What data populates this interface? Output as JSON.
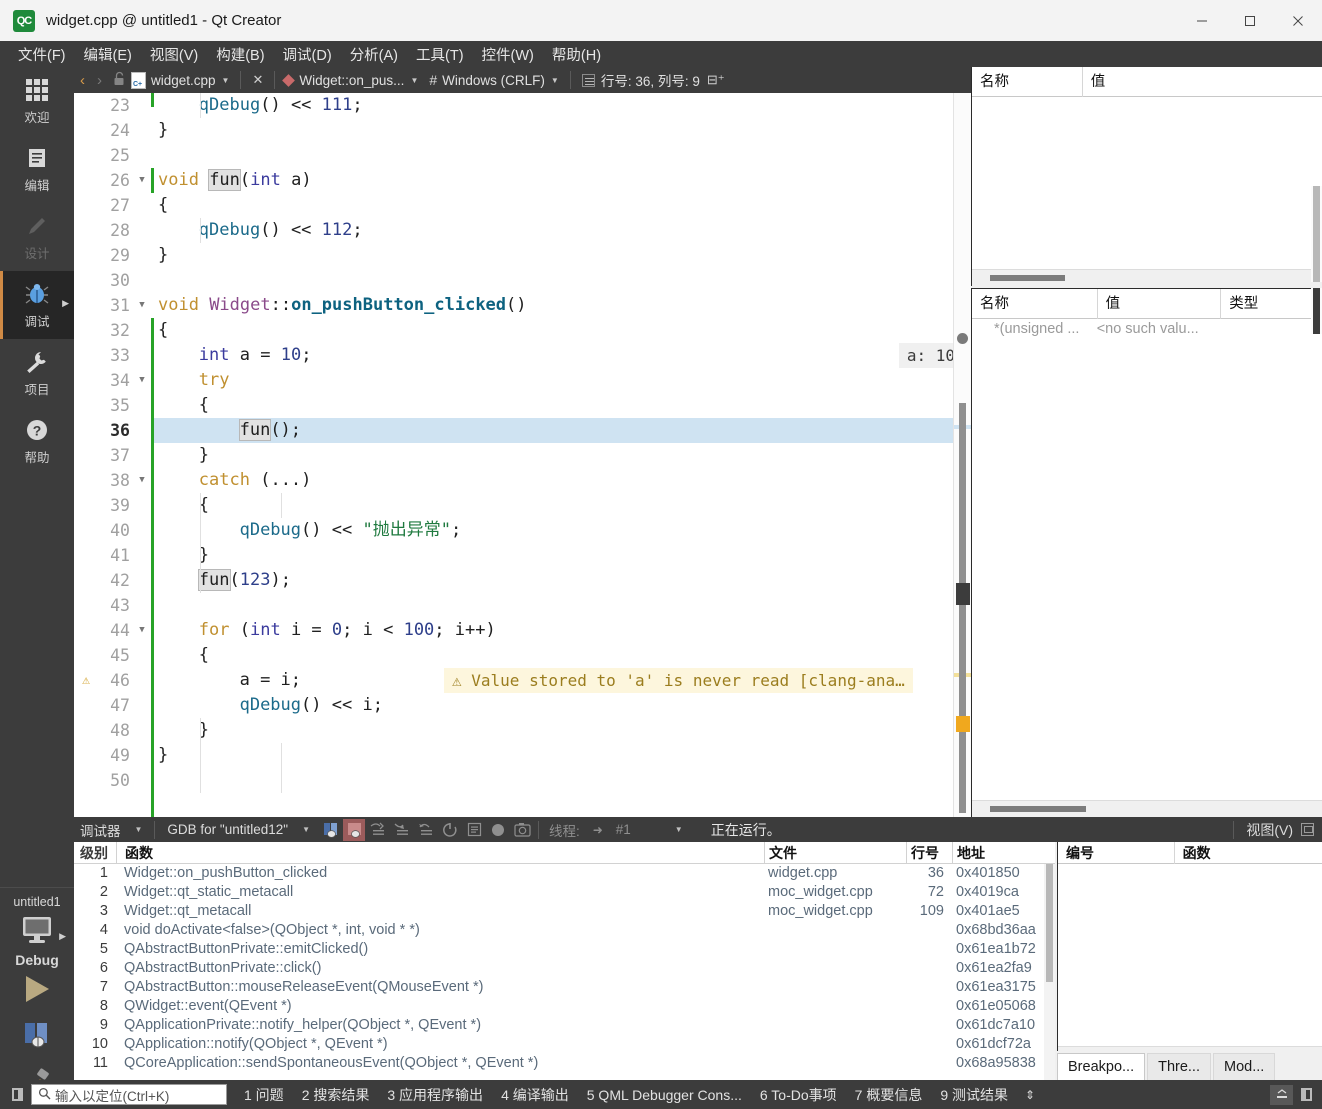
{
  "window": {
    "title": "widget.cpp @ untitled1 - Qt Creator",
    "app_badge": "QC",
    "minimize": "minimize-button",
    "maximize": "maximize-button",
    "close": "close-button"
  },
  "menubar": [
    {
      "label": "文件(F)",
      "key": "F"
    },
    {
      "label": "编辑(E)",
      "key": "E"
    },
    {
      "label": "视图(V)",
      "key": "V"
    },
    {
      "label": "构建(B)",
      "key": "B"
    },
    {
      "label": "调试(D)",
      "key": "D"
    },
    {
      "label": "分析(A)",
      "key": "A"
    },
    {
      "label": "工具(T)",
      "key": "T"
    },
    {
      "label": "控件(W)",
      "key": "W"
    },
    {
      "label": "帮助(H)",
      "key": "H"
    }
  ],
  "modebar": [
    {
      "label": "欢迎",
      "icon": "grid-icon",
      "state": "normal"
    },
    {
      "label": "编辑",
      "icon": "document-icon",
      "state": "normal"
    },
    {
      "label": "设计",
      "icon": "pencil-icon",
      "state": "disabled"
    },
    {
      "label": "调试",
      "icon": "bug-icon",
      "state": "active"
    },
    {
      "label": "项目",
      "icon": "wrench-icon",
      "state": "normal"
    },
    {
      "label": "帮助",
      "icon": "question-icon",
      "state": "normal"
    }
  ],
  "runblock": {
    "project": "untitled1",
    "kit_icon": "monitor-icon",
    "kit_label": "Debug",
    "run_icon": "run-triangle-icon",
    "debug_icon": "debug-start-icon",
    "build_icon": "hammer-icon"
  },
  "editor_toolbar": {
    "back": "‹",
    "forward": "›",
    "lock": "unlocked-icon",
    "filename": "widget.cpp",
    "close_label": "✕",
    "symbol": "Widget::on_pus...",
    "hash": "#",
    "line_ending": "Windows (CRLF)",
    "encoding_icon": "text-encoding-icon",
    "cursor_position": "行号: 36, 列号: 9",
    "split_icon": "split-editor-icon"
  },
  "code": {
    "lines": [
      {
        "n": "23",
        "indent": 4,
        "tokens": [
          {
            "t": "qDebug",
            "c": "fn"
          },
          {
            "t": "() ",
            "c": "plain"
          },
          {
            "t": "<< ",
            "c": "plain"
          },
          {
            "t": "111",
            "c": "num-lit"
          },
          {
            "t": ";",
            "c": "plain"
          }
        ]
      },
      {
        "n": "24",
        "indent": 0,
        "tokens": [
          {
            "t": "}",
            "c": "plain"
          }
        ]
      },
      {
        "n": "25",
        "indent": 0,
        "tokens": []
      },
      {
        "n": "26",
        "indent": 0,
        "fold": true,
        "tokens": [
          {
            "t": "void ",
            "c": "k"
          },
          {
            "t": "fun",
            "c": "plain occ"
          },
          {
            "t": "(",
            "c": "plain"
          },
          {
            "t": "int",
            "c": "ty"
          },
          {
            "t": " a)",
            "c": "plain"
          }
        ]
      },
      {
        "n": "27",
        "indent": 0,
        "tokens": [
          {
            "t": "{",
            "c": "plain"
          }
        ]
      },
      {
        "n": "28",
        "indent": 4,
        "tokens": [
          {
            "t": "qDebug",
            "c": "fn"
          },
          {
            "t": "() ",
            "c": "plain"
          },
          {
            "t": "<< ",
            "c": "plain"
          },
          {
            "t": "112",
            "c": "num-lit"
          },
          {
            "t": ";",
            "c": "plain"
          }
        ]
      },
      {
        "n": "29",
        "indent": 0,
        "tokens": [
          {
            "t": "}",
            "c": "plain"
          }
        ]
      },
      {
        "n": "30",
        "indent": 0,
        "tokens": []
      },
      {
        "n": "31",
        "indent": 0,
        "fold": true,
        "tokens": [
          {
            "t": "void ",
            "c": "k"
          },
          {
            "t": "Widget",
            "c": "cls"
          },
          {
            "t": "::",
            "c": "plain"
          },
          {
            "t": "on_pushButton_clicked",
            "c": "bold-fn"
          },
          {
            "t": "()",
            "c": "plain"
          }
        ]
      },
      {
        "n": "32",
        "indent": 0,
        "tokens": [
          {
            "t": "{",
            "c": "plain"
          }
        ]
      },
      {
        "n": "33",
        "indent": 4,
        "tokens": [
          {
            "t": "int",
            "c": "ty"
          },
          {
            "t": " a = ",
            "c": "plain"
          },
          {
            "t": "10",
            "c": "num-lit"
          },
          {
            "t": ";",
            "c": "plain"
          }
        ],
        "inline_value": "a: 10"
      },
      {
        "n": "34",
        "indent": 4,
        "fold": true,
        "tokens": [
          {
            "t": "try",
            "c": "k"
          }
        ]
      },
      {
        "n": "35",
        "indent": 4,
        "tokens": [
          {
            "t": "{",
            "c": "plain"
          }
        ]
      },
      {
        "n": "36",
        "indent": 8,
        "current": true,
        "highlight": true,
        "tokens": [
          {
            "t": "fun",
            "c": "plain occ"
          },
          {
            "t": "();",
            "c": "plain"
          }
        ]
      },
      {
        "n": "37",
        "indent": 4,
        "tokens": [
          {
            "t": "}",
            "c": "plain"
          }
        ]
      },
      {
        "n": "38",
        "indent": 4,
        "fold": true,
        "tokens": [
          {
            "t": "catch",
            "c": "k"
          },
          {
            "t": " (...)",
            "c": "plain"
          }
        ]
      },
      {
        "n": "39",
        "indent": 4,
        "tokens": [
          {
            "t": "{",
            "c": "plain"
          }
        ]
      },
      {
        "n": "40",
        "indent": 8,
        "tokens": [
          {
            "t": "qDebug",
            "c": "fn"
          },
          {
            "t": "() ",
            "c": "plain"
          },
          {
            "t": "<< ",
            "c": "plain"
          },
          {
            "t": "\"抛出异常\"",
            "c": "str"
          },
          {
            "t": ";",
            "c": "plain"
          }
        ]
      },
      {
        "n": "41",
        "indent": 4,
        "tokens": [
          {
            "t": "}",
            "c": "plain"
          }
        ]
      },
      {
        "n": "42",
        "indent": 4,
        "tokens": [
          {
            "t": "fun",
            "c": "plain occ"
          },
          {
            "t": "(",
            "c": "plain"
          },
          {
            "t": "123",
            "c": "num-lit"
          },
          {
            "t": ");",
            "c": "plain"
          }
        ]
      },
      {
        "n": "43",
        "indent": 0,
        "tokens": []
      },
      {
        "n": "44",
        "indent": 4,
        "fold": true,
        "tokens": [
          {
            "t": "for",
            "c": "k"
          },
          {
            "t": " (",
            "c": "plain"
          },
          {
            "t": "int",
            "c": "ty"
          },
          {
            "t": " i = ",
            "c": "plain"
          },
          {
            "t": "0",
            "c": "num-lit"
          },
          {
            "t": "; i < ",
            "c": "plain"
          },
          {
            "t": "100",
            "c": "num-lit"
          },
          {
            "t": "; i++)",
            "c": "plain"
          }
        ]
      },
      {
        "n": "45",
        "indent": 4,
        "tokens": [
          {
            "t": "{",
            "c": "plain"
          }
        ]
      },
      {
        "n": "46",
        "indent": 8,
        "warn": true,
        "tokens": [
          {
            "t": "a = i;",
            "c": "plain"
          }
        ],
        "inline_warning": "⚠ Value stored to 'a' is never read [clang-ana…"
      },
      {
        "n": "47",
        "indent": 8,
        "tokens": [
          {
            "t": "qDebug",
            "c": "fn"
          },
          {
            "t": "() ",
            "c": "plain"
          },
          {
            "t": "<< ",
            "c": "plain"
          },
          {
            "t": "i;",
            "c": "plain"
          }
        ]
      },
      {
        "n": "48",
        "indent": 4,
        "tokens": [
          {
            "t": "}",
            "c": "plain"
          }
        ]
      },
      {
        "n": "49",
        "indent": 0,
        "tokens": [
          {
            "t": "}",
            "c": "plain"
          }
        ]
      },
      {
        "n": "50",
        "indent": 0,
        "tokens": []
      }
    ]
  },
  "locals_panel": {
    "headers": [
      "名称",
      "值"
    ],
    "rows": []
  },
  "expressions_panel": {
    "headers": [
      "名称",
      "值",
      "类型"
    ],
    "rows": [
      {
        "name": "*(unsigned ...",
        "value": "<no such valu...",
        "type": ""
      }
    ]
  },
  "debug_toolbar": {
    "label": "调试器",
    "engine": "GDB for \"untitled12\"",
    "icons": [
      {
        "name": "continue-icon"
      },
      {
        "name": "interrupt-icon"
      },
      {
        "name": "step-over-icon"
      },
      {
        "name": "step-into-icon"
      },
      {
        "name": "step-out-icon"
      },
      {
        "name": "restart-icon"
      },
      {
        "name": "run-to-line-icon"
      },
      {
        "name": "record-icon"
      },
      {
        "name": "snapshot-icon"
      }
    ],
    "thread_label": "线程:",
    "thread_value": "#1",
    "status": "正在运行。",
    "view_label": "视图(V)"
  },
  "stack_panel": {
    "headers": [
      "级别",
      "函数",
      "文件",
      "行号",
      "地址"
    ],
    "rows": [
      {
        "level": "1",
        "func": "Widget::on_pushButton_clicked",
        "file": "widget.cpp",
        "line": "36",
        "addr": "0x401850"
      },
      {
        "level": "2",
        "func": "Widget::qt_static_metacall",
        "file": "moc_widget.cpp",
        "line": "72",
        "addr": "0x4019ca"
      },
      {
        "level": "3",
        "func": "Widget::qt_metacall",
        "file": "moc_widget.cpp",
        "line": "109",
        "addr": "0x401ae5"
      },
      {
        "level": "4",
        "func": "void doActivate<false>(QObject *, int, void * *)",
        "file": "",
        "line": "",
        "addr": "0x68bd36aa"
      },
      {
        "level": "5",
        "func": "QAbstractButtonPrivate::emitClicked()",
        "file": "",
        "line": "",
        "addr": "0x61ea1b72"
      },
      {
        "level": "6",
        "func": "QAbstractButtonPrivate::click()",
        "file": "",
        "line": "",
        "addr": "0x61ea2fa9"
      },
      {
        "level": "7",
        "func": "QAbstractButton::mouseReleaseEvent(QMouseEvent *)",
        "file": "",
        "line": "",
        "addr": "0x61ea3175"
      },
      {
        "level": "8",
        "func": "QWidget::event(QEvent *)",
        "file": "",
        "line": "",
        "addr": "0x61e05068"
      },
      {
        "level": "9",
        "func": "QApplicationPrivate::notify_helper(QObject *, QEvent *)",
        "file": "",
        "line": "",
        "addr": "0x61dc7a10"
      },
      {
        "level": "10",
        "func": "QApplication::notify(QObject *, QEvent *)",
        "file": "",
        "line": "",
        "addr": "0x61dcf72a"
      },
      {
        "level": "11",
        "func": "QCoreApplication::sendSpontaneousEvent(QObject *, QEvent *)",
        "file": "",
        "line": "",
        "addr": "0x68a95838"
      }
    ]
  },
  "breakpoints_panel": {
    "headers": [
      "编号",
      "函数"
    ],
    "rows": [],
    "tabs": [
      {
        "label": "Breakpo...",
        "active": true
      },
      {
        "label": "Thre...",
        "active": false
      },
      {
        "label": "Mod...",
        "active": false
      }
    ]
  },
  "statusbar": {
    "toggle_sidebar_icon": "sidebar-toggle-icon",
    "locator_placeholder": "输入以定位(Ctrl+K)",
    "search_icon": "search-icon",
    "panes": [
      "1 问题",
      "2 搜索结果",
      "3 应用程序输出",
      "4 编译输出",
      "5 QML Debugger Cons...",
      "6 To-Do事项",
      "7 概要信息",
      "9 测试结果"
    ],
    "updown": "⇕",
    "minimize_output_icon": "minimize-output-icon",
    "right_sidebar_icon": "right-sidebar-icon"
  },
  "colors": {
    "chrome": "#3c3c3c",
    "accent": "#d08a45",
    "title_bg": "#f3f3f3",
    "highlight_line": "#cfe3f2",
    "warn_bg": "#fdf6dd",
    "warn_fg": "#9b7d1e",
    "change_bar": "#27a327"
  }
}
